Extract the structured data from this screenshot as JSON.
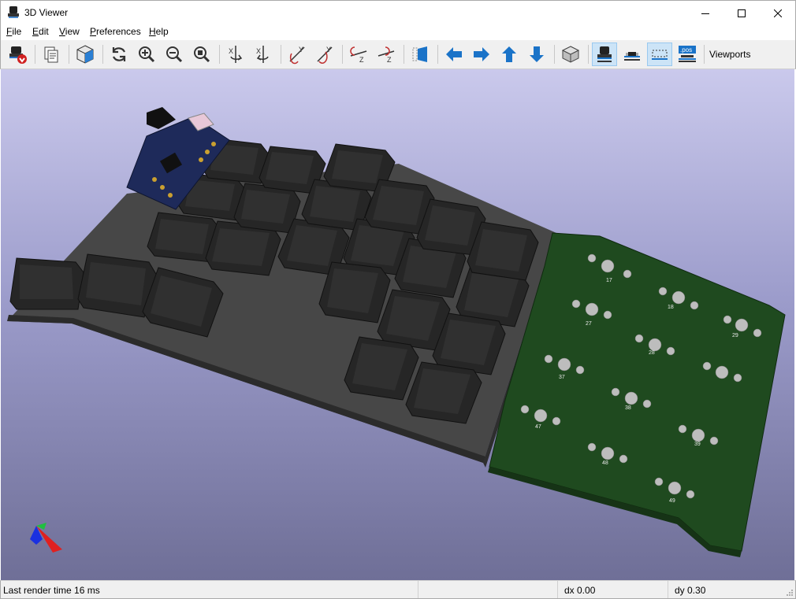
{
  "window": {
    "title": "3D Viewer"
  },
  "menu": [
    {
      "label": "File",
      "accel": "F",
      "rest": "ile"
    },
    {
      "label": "Edit",
      "accel": "E",
      "rest": "dit"
    },
    {
      "label": "View",
      "accel": "V",
      "rest": "iew"
    },
    {
      "label": "Preferences",
      "accel": "P",
      "rest": "references"
    },
    {
      "label": "Help",
      "accel": "H",
      "rest": "elp"
    }
  ],
  "toolbar": {
    "viewports_label": "Viewports",
    "pos_badge": ".pos",
    "tools": [
      "reload-board-icon",
      "copy-to-clipboard-icon",
      "raytrace-icon",
      "redraw-icon",
      "zoom-in-icon",
      "zoom-out-icon",
      "zoom-fit-icon",
      "rotate-x-cw-icon",
      "rotate-x-ccw-icon",
      "rotate-y-cw-icon",
      "rotate-y-ccw-icon",
      "rotate-z-cw-icon",
      "rotate-z-ccw-icon",
      "flip-board-icon",
      "pan-left-icon",
      "pan-right-icon",
      "pan-up-icon",
      "pan-down-icon",
      "ortho-view-icon",
      "show-tht-icon",
      "show-smd-icon",
      "show-virtual-icon",
      "show-pos-icon"
    ]
  },
  "colors": {
    "accent_blue": "#1a73c8",
    "pcb_green": "#1f4a1f",
    "case_gray": "#3c3c3c",
    "keycap": "#222222",
    "toggle_active_bg": "#cce4f7"
  },
  "viewport": {
    "pcb_labels": [
      "17",
      "18",
      "27",
      "28",
      "29",
      "37",
      "38",
      "39",
      "47",
      "48",
      "49"
    ]
  },
  "status": {
    "render_time": "Last render time 16 ms",
    "dx": "dx 0.00",
    "dy": "dy 0.30"
  }
}
